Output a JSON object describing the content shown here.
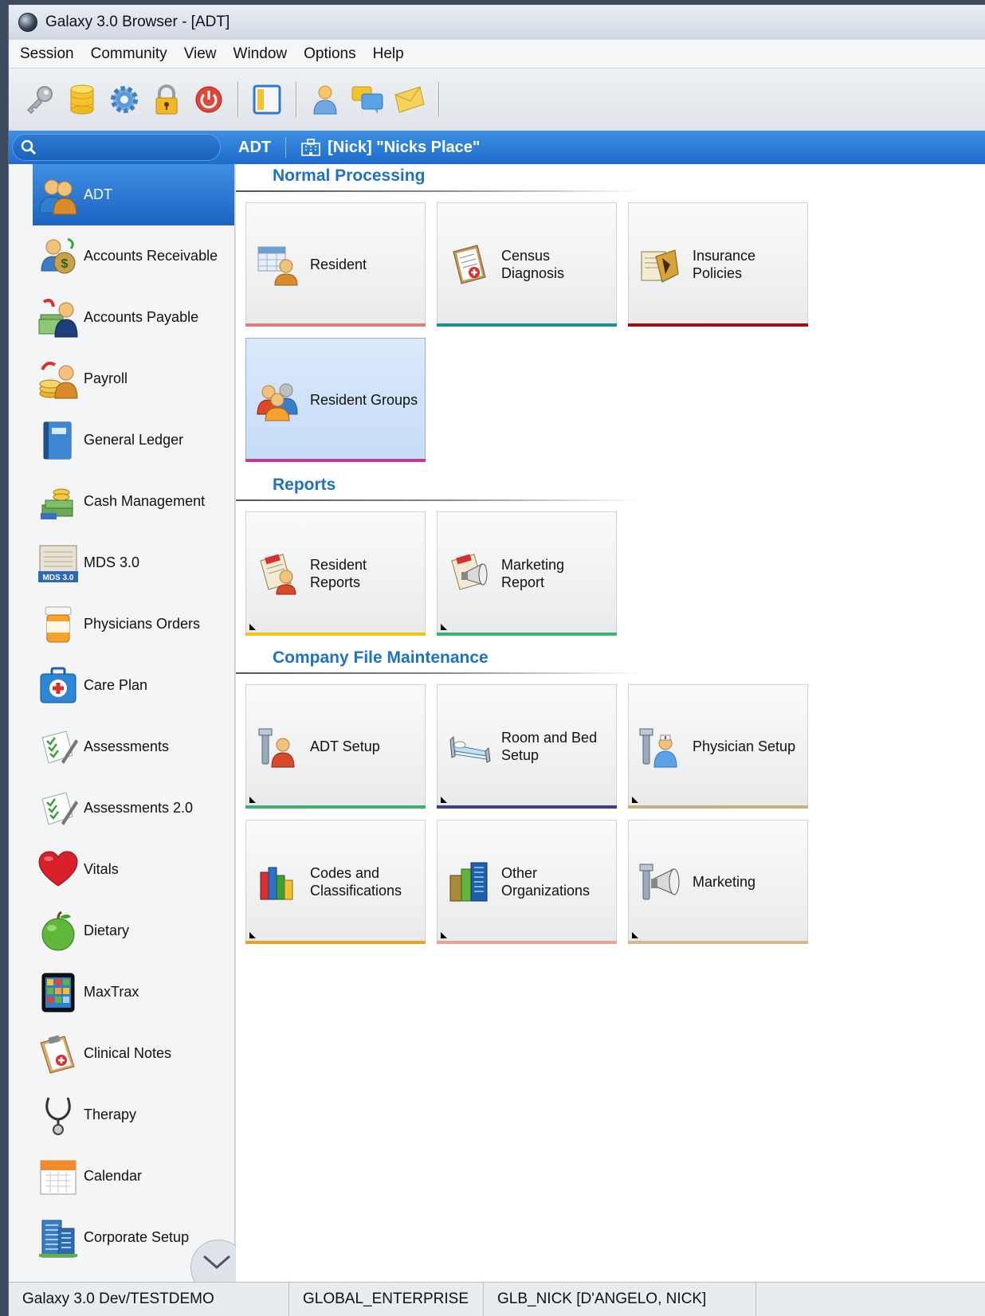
{
  "window": {
    "title": "Galaxy 3.0 Browser - [ADT]"
  },
  "menu": [
    "Session",
    "Community",
    "View",
    "Window",
    "Options",
    "Help"
  ],
  "toolbar": {
    "buttons": [
      "key-icon",
      "database-icon",
      "gear-icon",
      "lock-icon",
      "power-icon",
      "panel-icon",
      "user-icon",
      "chat-icon",
      "mail-icon"
    ]
  },
  "location": {
    "module": "ADT",
    "facility": "[Nick] \"Nicks Place\""
  },
  "sidebar": {
    "items": [
      {
        "label": "ADT",
        "active": true,
        "icon": "residents-icon"
      },
      {
        "label": "Accounts Receivable",
        "icon": "money-bag-icon"
      },
      {
        "label": "Accounts Payable",
        "icon": "payment-icon"
      },
      {
        "label": "Payroll",
        "icon": "coins-user-icon"
      },
      {
        "label": "General Ledger",
        "icon": "ledger-book-icon"
      },
      {
        "label": "Cash Management",
        "icon": "cash-stack-icon"
      },
      {
        "label": "MDS 3.0",
        "icon": "mds-form-icon"
      },
      {
        "label": "Physicians Orders",
        "icon": "pill-bottle-icon"
      },
      {
        "label": "Care Plan",
        "icon": "first-aid-kit-icon"
      },
      {
        "label": "Assessments",
        "icon": "checklist-icon"
      },
      {
        "label": "Assessments 2.0",
        "icon": "checklist-icon"
      },
      {
        "label": "Vitals",
        "icon": "heart-icon"
      },
      {
        "label": "Dietary",
        "icon": "apple-icon"
      },
      {
        "label": "MaxTrax",
        "icon": "tablet-icon"
      },
      {
        "label": "Clinical Notes",
        "icon": "clipboard-icon"
      },
      {
        "label": "Therapy",
        "icon": "stethoscope-icon"
      },
      {
        "label": "Calendar",
        "icon": "calendar-icon"
      },
      {
        "label": "Corporate Setup",
        "icon": "building-icon"
      }
    ]
  },
  "sections": [
    {
      "title": "Normal Processing",
      "tiles": [
        {
          "label": "Resident",
          "accent": "#e07b7b",
          "icon": "resident-icon"
        },
        {
          "label": "Census\nDiagnosis",
          "accent": "#1f8f8f",
          "icon": "diagnosis-icon"
        },
        {
          "label": "Insurance\nPolicies",
          "accent": "#9a1212",
          "icon": "insurance-icon"
        },
        {
          "label": "Resident Groups",
          "accent": "#c43a8f",
          "icon": "resident-groups-icon",
          "selected": true
        }
      ]
    },
    {
      "title": "Reports",
      "tiles": [
        {
          "label": "Resident\nReports",
          "accent": "#f0c419",
          "icon": "report-icon"
        },
        {
          "label": "Marketing\nReport",
          "accent": "#3cb371",
          "icon": "marketing-report-icon"
        }
      ]
    },
    {
      "title": "Company File Maintenance",
      "tiles": [
        {
          "label": "ADT Setup",
          "accent": "#3cb371",
          "icon": "setup-icon"
        },
        {
          "label": "Room and Bed\nSetup",
          "accent": "#3b3b9a",
          "icon": "bed-icon"
        },
        {
          "label": "Physician Setup",
          "accent": "#c8b27a",
          "icon": "physician-icon"
        },
        {
          "label": "Codes and\nClassifications",
          "accent": "#f0a020",
          "icon": "books-icon"
        },
        {
          "label": "Other\nOrganizations",
          "accent": "#f0a090",
          "icon": "organizations-icon"
        },
        {
          "label": "Marketing",
          "accent": "#d8b88a",
          "icon": "megaphone-icon"
        }
      ]
    }
  ],
  "status": {
    "environment": "Galaxy 3.0 Dev/TESTDEMO",
    "enterprise": "GLOBAL_ENTERPRISE",
    "user": "GLB_NICK [D'ANGELO, NICK]"
  }
}
